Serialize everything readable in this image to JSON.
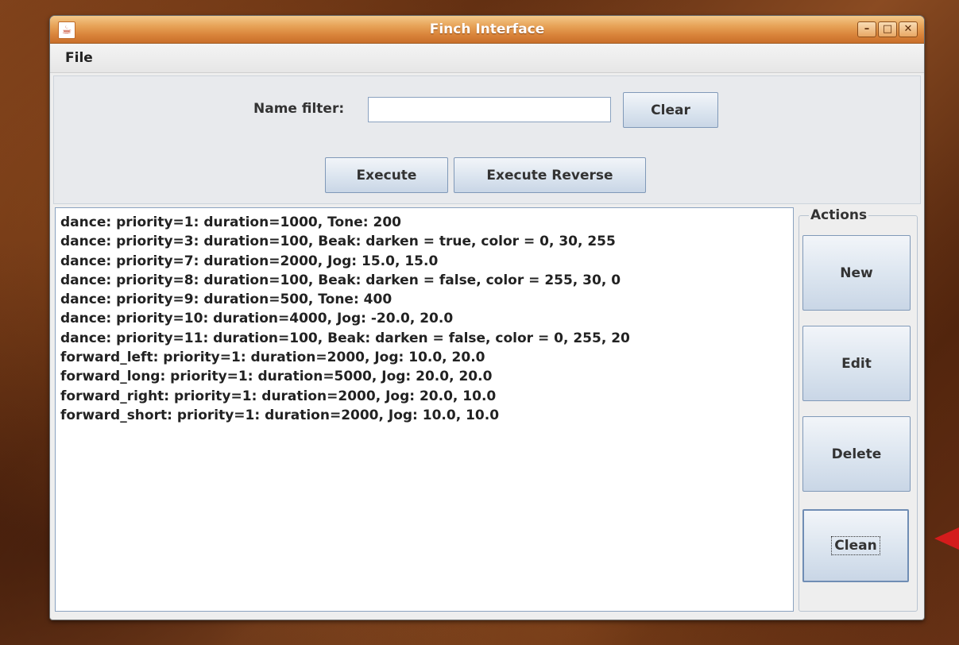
{
  "window": {
    "title": "Finch Interface",
    "app_icon": "java-icon",
    "controls": [
      "minimize-icon",
      "maximize-icon",
      "close-icon"
    ]
  },
  "menu": {
    "file": "File"
  },
  "filter": {
    "label": "Name filter:",
    "value": "",
    "clear_label": "Clear"
  },
  "run": {
    "execute_label": "Execute",
    "execute_reverse_label": "Execute Reverse"
  },
  "list": {
    "items": [
      "dance: priority=1: duration=1000, Tone: 200",
      "dance: priority=3: duration=100, Beak: darken = true, color = 0, 30, 255",
      "dance: priority=7: duration=2000, Jog: 15.0, 15.0",
      "dance: priority=8: duration=100, Beak: darken = false, color = 255, 30, 0",
      "dance: priority=9: duration=500, Tone: 400",
      "dance: priority=10: duration=4000, Jog: -20.0, 20.0",
      "dance: priority=11: duration=100, Beak: darken = false, color = 0, 255, 20",
      "forward_left: priority=1: duration=2000, Jog: 10.0, 20.0",
      "forward_long: priority=1: duration=5000, Jog: 20.0, 20.0",
      "forward_right: priority=1: duration=2000, Jog: 20.0, 10.0",
      "forward_short: priority=1: duration=2000, Jog: 10.0, 10.0"
    ]
  },
  "actions": {
    "title": "Actions",
    "new_label": "New",
    "edit_label": "Edit",
    "delete_label": "Delete",
    "clean_label": "Clean"
  },
  "colors": {
    "titlebar": "#d9843a",
    "button_border": "#8099b8",
    "pointer_arrow": "#d41c1c"
  }
}
